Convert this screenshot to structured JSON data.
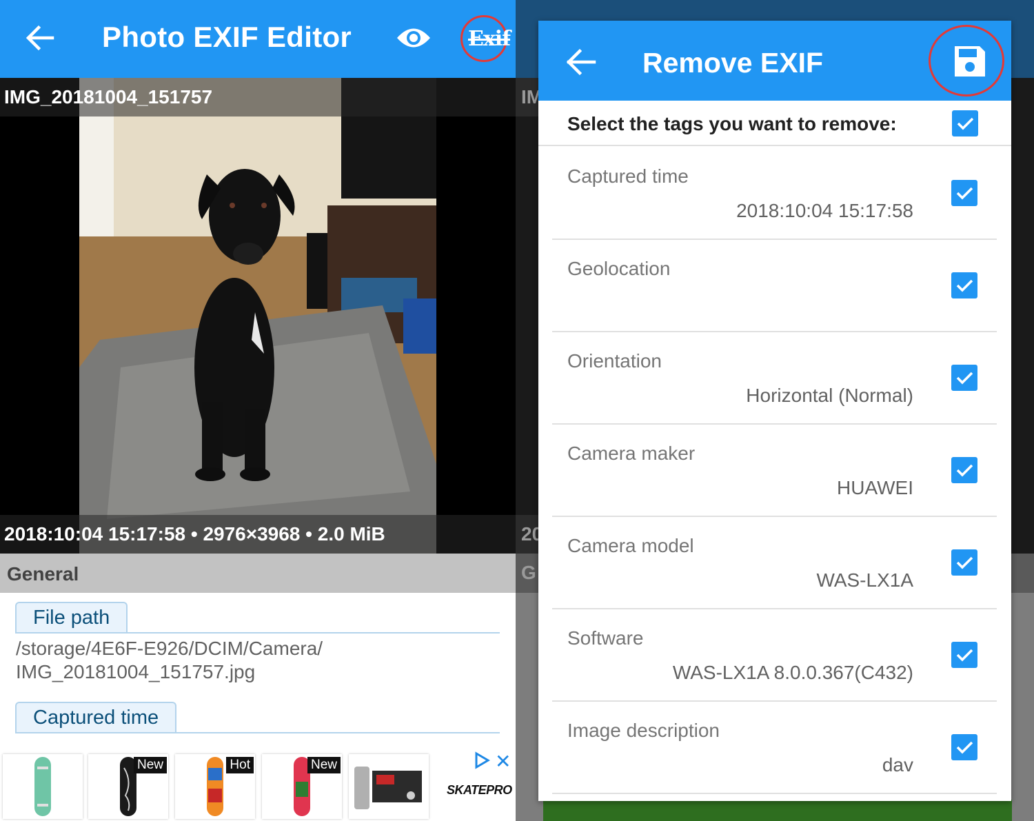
{
  "left": {
    "appbar": {
      "title": "Photo EXIF Editor",
      "back_icon": "arrow-back-icon",
      "view_icon": "eye-icon",
      "exif_button_label": "Exif",
      "accent_color": "#2196f3",
      "highlight_color": "#e53935"
    },
    "photo": {
      "filename": "IMG_20181004_151757",
      "info": "2018:10:04 15:17:58 • 2976×3968 • 2.0 MiB"
    },
    "section": {
      "title": "General"
    },
    "fields": [
      {
        "label": "File path",
        "value_line1": "/storage/4E6F-E926/DCIM/Camera/",
        "value_line2": "IMG_20181004_151757.jpg"
      },
      {
        "label": "Captured time"
      }
    ],
    "ad": {
      "brand": "SKATEPRO",
      "badges": [
        "New",
        "Hot",
        "New"
      ],
      "close_label": "✕"
    }
  },
  "right": {
    "background": {
      "cap_top": "IM",
      "cap_bottom": "20",
      "section": "G"
    },
    "dialog": {
      "title": "Remove EXIF",
      "back_icon": "arrow-back-icon",
      "save_icon": "floppy-disk-icon",
      "select_prompt": "Select the tags you want to remove:",
      "tags": [
        {
          "label": "Captured time",
          "value": "2018:10:04 15:17:58",
          "checked": true
        },
        {
          "label": "Geolocation",
          "value": "",
          "checked": true
        },
        {
          "label": "Orientation",
          "value": "Horizontal (Normal)",
          "checked": true
        },
        {
          "label": "Camera maker",
          "value": "HUAWEI",
          "checked": true
        },
        {
          "label": "Camera model",
          "value": "WAS-LX1A",
          "checked": true
        },
        {
          "label": "Software",
          "value": "WAS-LX1A 8.0.0.367(C432)",
          "checked": true
        },
        {
          "label": "Image description",
          "value": "dav",
          "checked": true
        }
      ]
    }
  }
}
